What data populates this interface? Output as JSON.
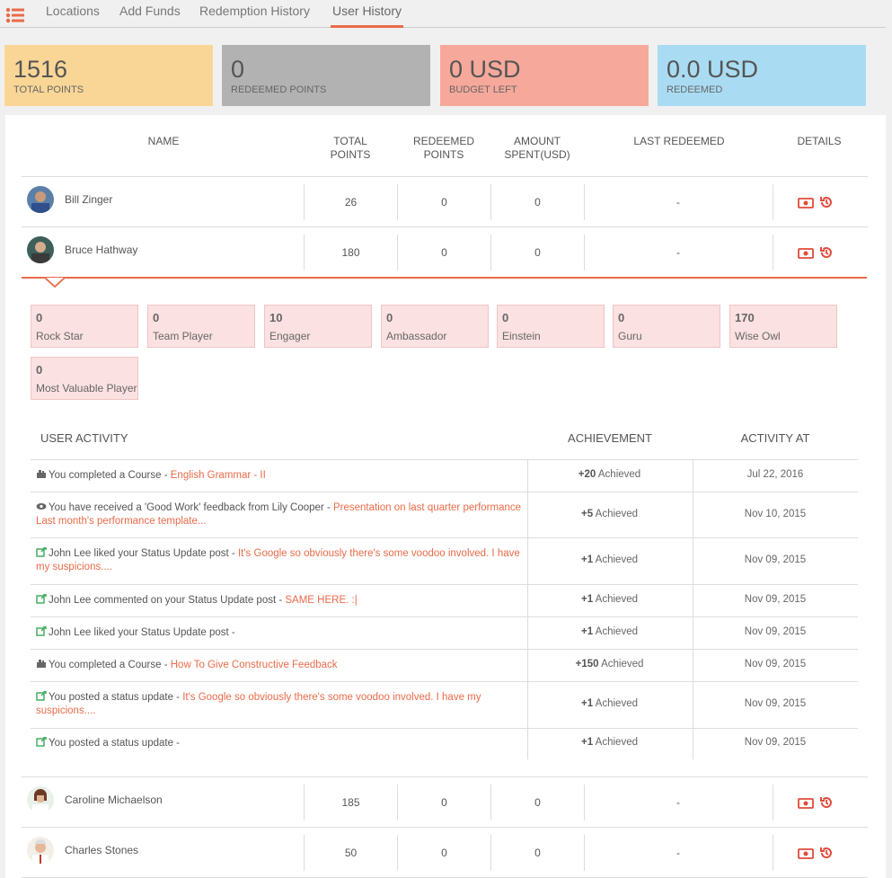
{
  "nav": {
    "tabs": [
      {
        "label": "Locations"
      },
      {
        "label": "Add Funds"
      },
      {
        "label": "Redemption History"
      },
      {
        "label": "User History"
      }
    ],
    "active_tab": "User History"
  },
  "stats": [
    {
      "value": "1516",
      "label": "TOTAL POINTS",
      "color": "#f9d696"
    },
    {
      "value": "0",
      "label": "REDEEMED POINTS",
      "color": "#b2b2b2"
    },
    {
      "value": "0 USD",
      "label": "BUDGET LEFT",
      "color": "#f6a89a"
    },
    {
      "value": "0.0 USD",
      "label": "REDEEMED",
      "color": "#a9dcf3"
    }
  ],
  "table": {
    "headers": {
      "name": "NAME",
      "total_points": "TOTAL POINTS",
      "redeemed_points": "REDEEMED POINTS",
      "amount_spent": "AMOUNT SPENT(USD)",
      "last_redeemed": "LAST REDEEMED",
      "details": "DETAILS"
    },
    "users": [
      {
        "name": "Bill Zinger",
        "total": "26",
        "redeemed": "0",
        "spent": "0",
        "last": "-"
      },
      {
        "name": "Bruce Hathway",
        "total": "180",
        "redeemed": "0",
        "spent": "0",
        "last": "-"
      },
      {
        "name": "Caroline Michaelson",
        "total": "185",
        "redeemed": "0",
        "spent": "0",
        "last": "-"
      },
      {
        "name": "Charles Stones",
        "total": "50",
        "redeemed": "0",
        "spent": "0",
        "last": "-"
      }
    ]
  },
  "badges": [
    {
      "value": "0",
      "label": "Rock Star"
    },
    {
      "value": "0",
      "label": "Team Player"
    },
    {
      "value": "10",
      "label": "Engager"
    },
    {
      "value": "0",
      "label": "Ambassador"
    },
    {
      "value": "0",
      "label": "Einstein"
    },
    {
      "value": "0",
      "label": "Guru"
    },
    {
      "value": "170",
      "label": "Wise Owl"
    },
    {
      "value": "0",
      "label": "Most Valuable Player"
    }
  ],
  "activity": {
    "headers": {
      "activity": "USER ACTIVITY",
      "achievement": "ACHIEVEMENT",
      "at": "ACTIVITY AT"
    },
    "rows": [
      {
        "icon": "course-icon",
        "text": "You completed a Course - ",
        "link": "English Grammar - II",
        "points": "+20",
        "suffix": " Achieved",
        "date": "Jul 22, 2016"
      },
      {
        "icon": "eye-icon",
        "text": "You have received a 'Good Work' feedback from Lily Cooper - ",
        "link": "Presentation on last quarter performance Last month's performance template...",
        "points": "+5",
        "suffix": " Achieved",
        "date": "Nov 10, 2015"
      },
      {
        "icon": "external-link-icon",
        "text": "John Lee liked your Status Update post - ",
        "link": "It's Google so obviously there's some voodoo involved. I have my suspicions....",
        "points": "+1",
        "suffix": " Achieved",
        "date": "Nov 09, 2015"
      },
      {
        "icon": "external-link-icon",
        "text": "John Lee commented on your Status Update post - ",
        "link": "SAME HERE. :|",
        "points": "+1",
        "suffix": " Achieved",
        "date": "Nov 09, 2015"
      },
      {
        "icon": "external-link-icon",
        "text": "John Lee liked your Status Update post - ",
        "link": "",
        "points": "+1",
        "suffix": " Achieved",
        "date": "Nov 09, 2015"
      },
      {
        "icon": "course-icon",
        "text": "You completed a Course - ",
        "link": "How To Give Constructive Feedback",
        "points": "+150",
        "suffix": " Achieved",
        "date": "Nov 09, 2015"
      },
      {
        "icon": "external-link-icon",
        "text": "You posted a status update - ",
        "link": "It's Google so obviously there's some voodoo involved. I have my suspicions....",
        "points": "+1",
        "suffix": " Achieved",
        "date": "Nov 09, 2015"
      },
      {
        "icon": "external-link-icon",
        "text": "You posted a status update - ",
        "link": "",
        "points": "+1",
        "suffix": " Achieved",
        "date": "Nov 09, 2015"
      }
    ]
  },
  "colors": {
    "accent": "#e96b49",
    "link_green": "#3aa957"
  }
}
